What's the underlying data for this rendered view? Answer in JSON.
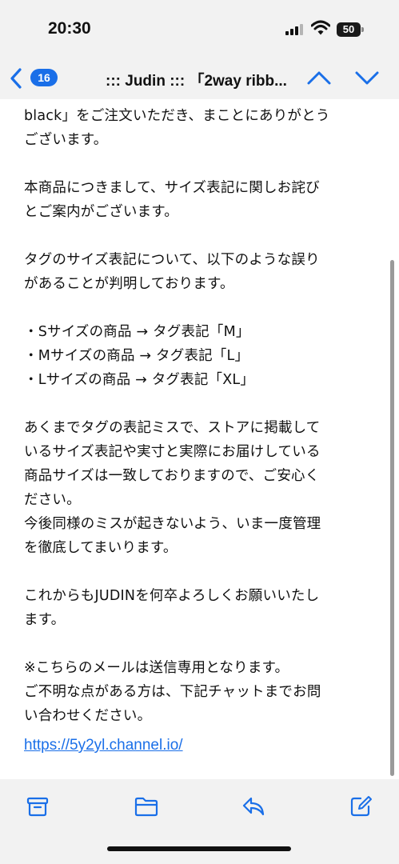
{
  "status_bar": {
    "time": "20:30",
    "battery": "50",
    "icons": [
      "signal-icon",
      "wifi-icon",
      "battery-icon"
    ]
  },
  "nav": {
    "back_count": "16",
    "title": "::: Judin ::: 「2way ribb...",
    "icons": [
      "back-chevron-icon",
      "chevron-up-icon",
      "chevron-down-icon"
    ]
  },
  "email": {
    "body": "black」をご注文いただき、まことにありがとう\nございます。\n\n本商品につきまして、サイズ表記に関しお詫び\nとご案内がございます。\n\nタグのサイズ表記について、以下のような誤り\nがあることが判明しております。\n\n・Sサイズの商品 → タグ表記「M」\n・Mサイズの商品 → タグ表記「L」\n・Lサイズの商品 → タグ表記「XL」\n\nあくまでタグの表記ミスで、ストアに掲載して\nいるサイズ表記や実寸と実際にお届けしている\n商品サイズは一致しておりますので、ご安心く\nださい。\n今後同様のミスが起きないよう、いま一度管理\nを徹底してまいります。\n\nこれからもJUDINを何卒よろしくお願いいたし\nます。\n\n※こちらのメールは送信専用となります。\nご不明な点がある方は、下記チャットまでお問\nい合わせください。",
    "link": "https://5y2yl.channel.io/"
  },
  "toolbar": {
    "icons": [
      "archive-icon",
      "folder-icon",
      "reply-icon",
      "compose-icon"
    ]
  },
  "colors": {
    "accent": "#1a6fe8",
    "background": "#f2f2f2",
    "content": "#ffffff"
  }
}
